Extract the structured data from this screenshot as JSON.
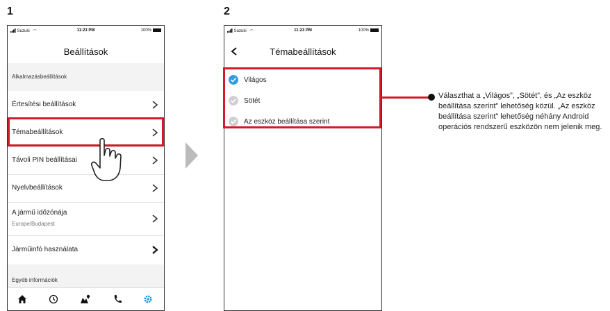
{
  "steps": {
    "first": "1",
    "second": "2"
  },
  "status_bar": {
    "carrier": "Suzuki",
    "time": "11:23 PM",
    "battery": "100%"
  },
  "screen1": {
    "title": "Beállítások",
    "section_app": "Alkalmazásbeállítások",
    "items": [
      {
        "label": "Értesítési beállítások"
      },
      {
        "label": "Témabeállítások"
      },
      {
        "label": "Távoli PIN beállításai"
      },
      {
        "label": "Nyelvbeállítások"
      },
      {
        "label": "A jármű időzónája",
        "sub": "Europe/Budapest"
      },
      {
        "label": "Járműinfó használata"
      }
    ],
    "section_other": "Egyéb információk",
    "tabs": [
      "home-icon",
      "history-icon",
      "map-icon",
      "phone-icon",
      "settings-icon"
    ],
    "active_tab_color": "#1a9ad8"
  },
  "screen2": {
    "title": "Témabeállítások",
    "options": [
      {
        "label": "Világos",
        "selected": true
      },
      {
        "label": "Sötét",
        "selected": false
      },
      {
        "label": "Az eszköz beállítása szerint",
        "selected": false
      }
    ]
  },
  "note": {
    "text": "Választhat a „Világos”, „Sötét”, és „Az eszköz beállítása szerint” lehetőség közül. „Az eszköz beállítása szerint” lehetőség néhány Android operációs rendszerű eszközön nem jelenik meg."
  },
  "colors": {
    "highlight": "#d11a2a",
    "check_selected": "#2d9ce0",
    "check_unselected": "#cfcfcf"
  }
}
